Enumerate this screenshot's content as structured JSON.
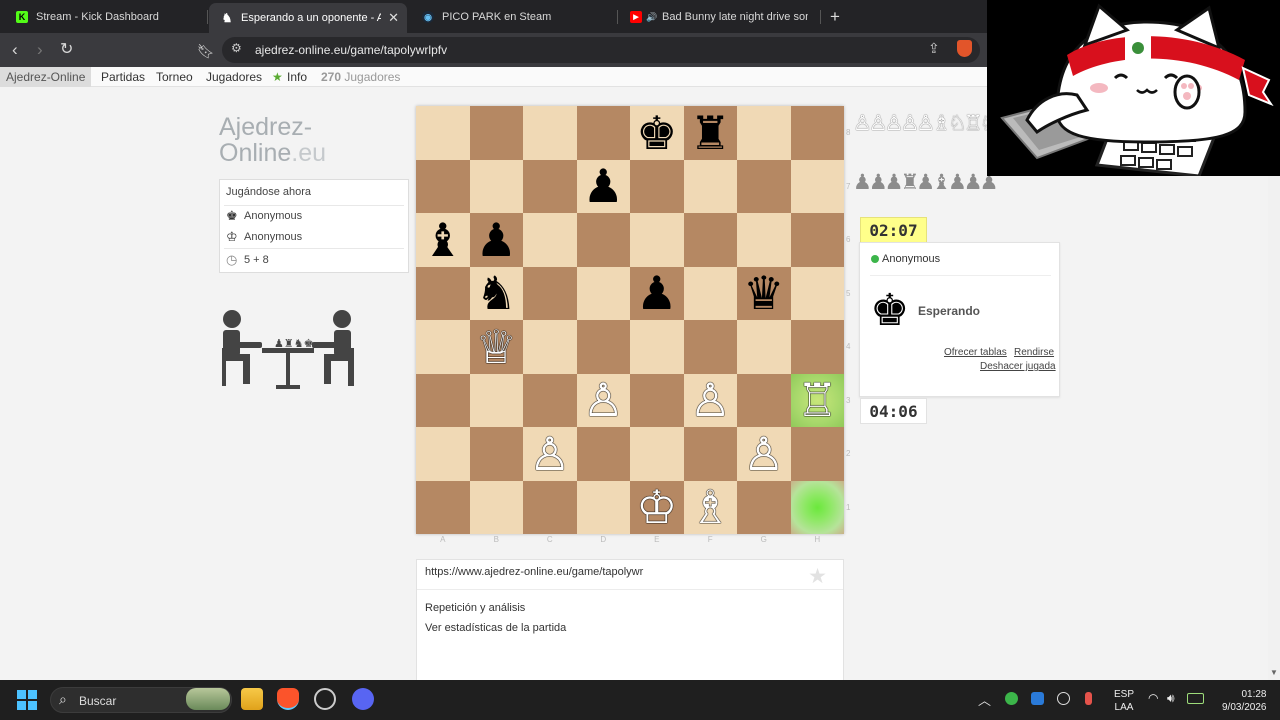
{
  "browser": {
    "tabs": [
      {
        "title": "Stream - Kick Dashboard",
        "icon": "kick-icon"
      },
      {
        "title": "Esperando a un oponente - Ajedrez",
        "icon": "knight-icon"
      },
      {
        "title": "PICO PARK en Steam",
        "icon": "steam-icon"
      },
      {
        "title": "Bad Bunny late night drive songs",
        "icon": "youtube-icon"
      }
    ],
    "close_glyph": "✕",
    "new_tab_glyph": "+",
    "url": "ajedrez-online.eu/game/tapolywrlpfv"
  },
  "nav": {
    "brand": "Ajedrez-Online",
    "items": [
      "Partidas",
      "Torneo",
      "Jugadores"
    ],
    "info_star": "★",
    "info": "Info",
    "players_count": "270",
    "players_label": "Jugadores"
  },
  "logo": {
    "line1": "Ajedrez-",
    "line2": "Online",
    "tld": ".eu"
  },
  "now_playing": {
    "title": "Jugándose ahora",
    "black_player": "Anonymous",
    "white_player": "Anonymous",
    "time_control": "5 + 8"
  },
  "board": {
    "files": [
      "A",
      "B",
      "C",
      "D",
      "E",
      "F",
      "G",
      "H"
    ],
    "ranks": [
      "8",
      "7",
      "6",
      "5",
      "4",
      "3",
      "2",
      "1"
    ],
    "position": [
      [
        "",
        "",
        "",
        "",
        "♚",
        "♜",
        "",
        ""
      ],
      [
        "",
        "",
        "",
        "♟",
        "",
        "",
        "",
        ""
      ],
      [
        "♝",
        "♟",
        "",
        "",
        "",
        "",
        "",
        ""
      ],
      [
        "",
        "♞",
        "",
        "",
        "♟",
        "",
        "♛",
        ""
      ],
      [
        "",
        "♕",
        "",
        "",
        "",
        "",
        "",
        ""
      ],
      [
        "",
        "",
        "",
        "♙",
        "",
        "♙",
        "",
        "♖"
      ],
      [
        "",
        "",
        "♙",
        "",
        "",
        "",
        "♙",
        ""
      ],
      [
        "",
        "",
        "",
        "",
        "♔",
        "♗",
        "",
        ""
      ]
    ],
    "highlight_from": "h1",
    "highlight_to": "h3"
  },
  "captured": {
    "white_pieces": "♙♙♙♙♙♗♘♖♘♙♙",
    "black_pieces": "♟♟♟♜♟♝♟♟♟"
  },
  "clocks": {
    "opponent": "02:07",
    "player": "04:06"
  },
  "opponent": {
    "name": "Anonymous",
    "king_glyph": "♚",
    "status": "Esperando",
    "actions": {
      "draw": "Ofrecer tablas",
      "resign": "Rendirse",
      "undo": "Deshacer jugada"
    }
  },
  "game_info": {
    "url": "https://www.ajedrez-online.eu/game/tapolywr",
    "fav_glyph": "★",
    "replay": "Repetición y análisis",
    "stats": "Ver estadísticas de la partida"
  },
  "taskbar": {
    "search": "Buscar",
    "lang_1": "ESP",
    "lang_2": "LAA",
    "time": "01:28",
    "date": "9/03/2026"
  },
  "colors": {
    "light_square": "#f0d9b5",
    "dark_square": "#b58863",
    "clock_active": "#ffff8a",
    "online_dot": "#3cb54a"
  }
}
